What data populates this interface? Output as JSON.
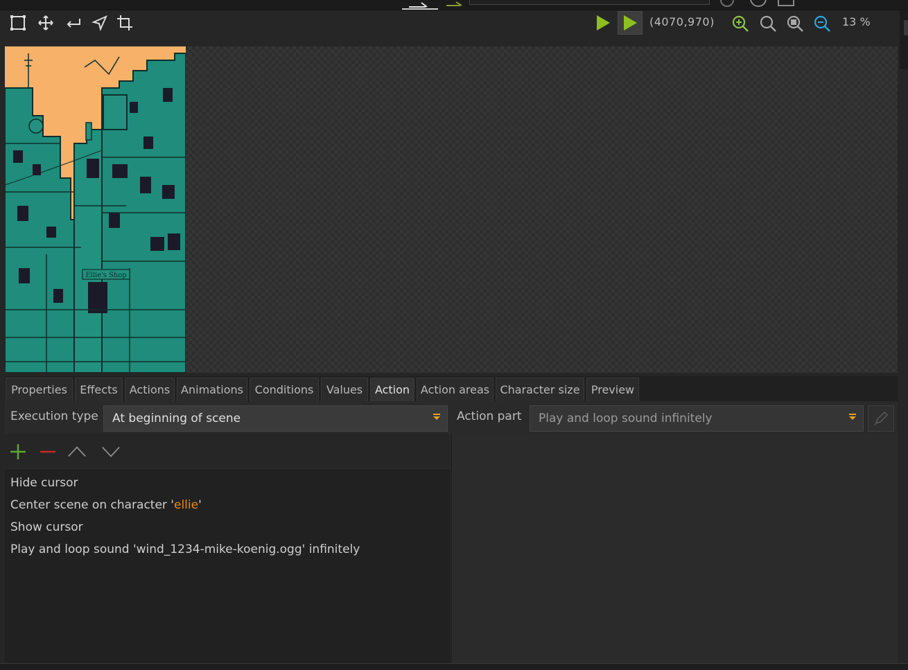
{
  "toolbar": {
    "tools": [
      "select-rect-icon",
      "move-icon",
      "return-icon",
      "cursor-arrow-icon",
      "crop-icon"
    ],
    "coords": "(4070,970)",
    "zoom_percent": "13 %"
  },
  "colors": {
    "accent_green": "#8bc34a",
    "play_green": "#8fbf1f",
    "dropdown_arrow": "#e8a317",
    "highlight_orange": "#e88a1a",
    "scene_sky": "#f7b169",
    "scene_buildings": "#1f8c7c"
  },
  "tabs": [
    {
      "label": "Properties"
    },
    {
      "label": "Effects"
    },
    {
      "label": "Actions"
    },
    {
      "label": "Animations"
    },
    {
      "label": "Conditions"
    },
    {
      "label": "Values"
    },
    {
      "label": "Action"
    },
    {
      "label": "Action areas"
    },
    {
      "label": "Character size"
    },
    {
      "label": "Preview"
    }
  ],
  "active_tab": "Action",
  "execution": {
    "label": "Execution type",
    "value": "At beginning of scene"
  },
  "action_part": {
    "label": "Action part",
    "value": "Play and loop sound infinitely"
  },
  "scene": {
    "sign_text": "Ellie's Shop"
  },
  "actions_list": [
    {
      "text": "Hide cursor"
    },
    {
      "prefix": "Center scene on character '",
      "highlight": "ellie",
      "suffix": "'"
    },
    {
      "text": "Show cursor"
    },
    {
      "text": "Play and loop sound 'wind_1234-mike-koenig.ogg' infinitely"
    }
  ]
}
